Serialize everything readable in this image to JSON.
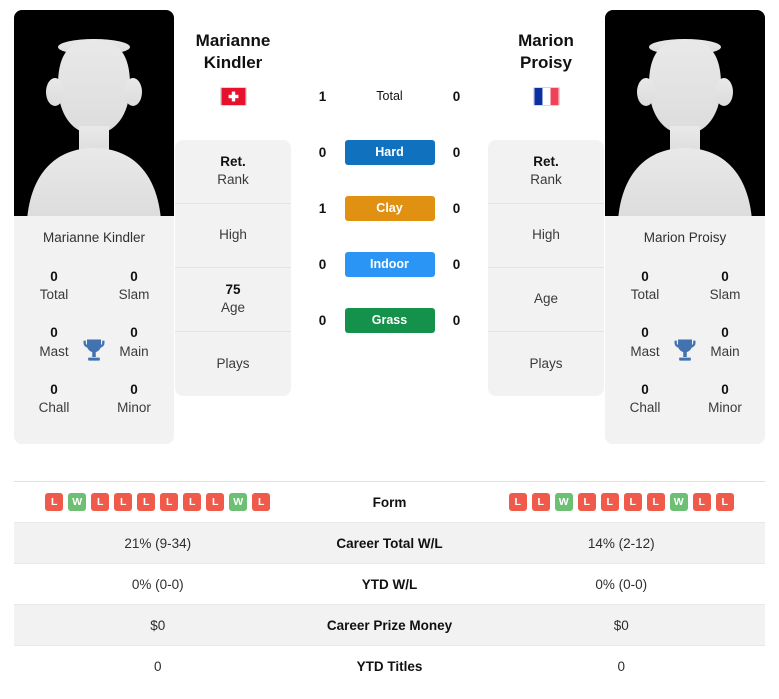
{
  "players": {
    "left": {
      "name_line1": "Marianne",
      "name_line2": "Kindler",
      "full_name": "Marianne Kindler",
      "country": "Switzerland",
      "flag_icon": "flag-switzerland-icon",
      "trophies": {
        "total_value": "0",
        "total_label": "Total",
        "slam_value": "0",
        "slam_label": "Slam",
        "mast_value": "0",
        "mast_label": "Mast",
        "main_value": "0",
        "main_label": "Main",
        "chall_value": "0",
        "chall_label": "Chall",
        "minor_value": "0",
        "minor_label": "Minor"
      },
      "info": [
        {
          "value": "Ret.",
          "label": "Rank"
        },
        {
          "value": "",
          "label": "High"
        },
        {
          "value": "75",
          "label": "Age"
        },
        {
          "value": "",
          "label": "Plays"
        }
      ],
      "surfaces": {
        "total": "1",
        "hard": "0",
        "clay": "1",
        "indoor": "0",
        "grass": "0"
      },
      "form": [
        "L",
        "W",
        "L",
        "L",
        "L",
        "L",
        "L",
        "L",
        "W",
        "L"
      ],
      "career_total_wl": "21% (9-34)",
      "ytd_wl": "0% (0-0)",
      "career_prize_money": "$0",
      "ytd_titles": "0"
    },
    "right": {
      "name_line1": "Marion",
      "name_line2": "Proisy",
      "full_name": "Marion Proisy",
      "country": "France",
      "flag_icon": "flag-france-icon",
      "trophies": {
        "total_value": "0",
        "total_label": "Total",
        "slam_value": "0",
        "slam_label": "Slam",
        "mast_value": "0",
        "mast_label": "Mast",
        "main_value": "0",
        "main_label": "Main",
        "chall_value": "0",
        "chall_label": "Chall",
        "minor_value": "0",
        "minor_label": "Minor"
      },
      "info": [
        {
          "value": "Ret.",
          "label": "Rank"
        },
        {
          "value": "",
          "label": "High"
        },
        {
          "value": "",
          "label": "Age"
        },
        {
          "value": "",
          "label": "Plays"
        }
      ],
      "surfaces": {
        "total": "0",
        "hard": "0",
        "clay": "0",
        "indoor": "0",
        "grass": "0"
      },
      "form": [
        "L",
        "L",
        "W",
        "L",
        "L",
        "L",
        "L",
        "W",
        "L",
        "L"
      ],
      "career_total_wl": "14% (2-12)",
      "ytd_wl": "0% (0-0)",
      "career_prize_money": "$0",
      "ytd_titles": "0"
    }
  },
  "surface_labels": {
    "total": "Total",
    "hard": "Hard",
    "clay": "Clay",
    "indoor": "Indoor",
    "grass": "Grass"
  },
  "surface_colors": {
    "hard": "#1072be",
    "clay": "#e09112",
    "indoor": "#2a95f5",
    "grass": "#14914a"
  },
  "comparison_rows": {
    "form": "Form",
    "career_total_wl": "Career Total W/L",
    "ytd_wl": "YTD W/L",
    "career_prize_money": "Career Prize Money",
    "ytd_titles": "YTD Titles"
  },
  "colors": {
    "win_badge": "#6cbf73",
    "loss_badge": "#f05a4b",
    "trophy": "#4272b0",
    "card_bg": "#f2f2f2"
  },
  "icons": {
    "trophy": "trophy-icon",
    "avatar": "player-avatar-silhouette-icon"
  }
}
